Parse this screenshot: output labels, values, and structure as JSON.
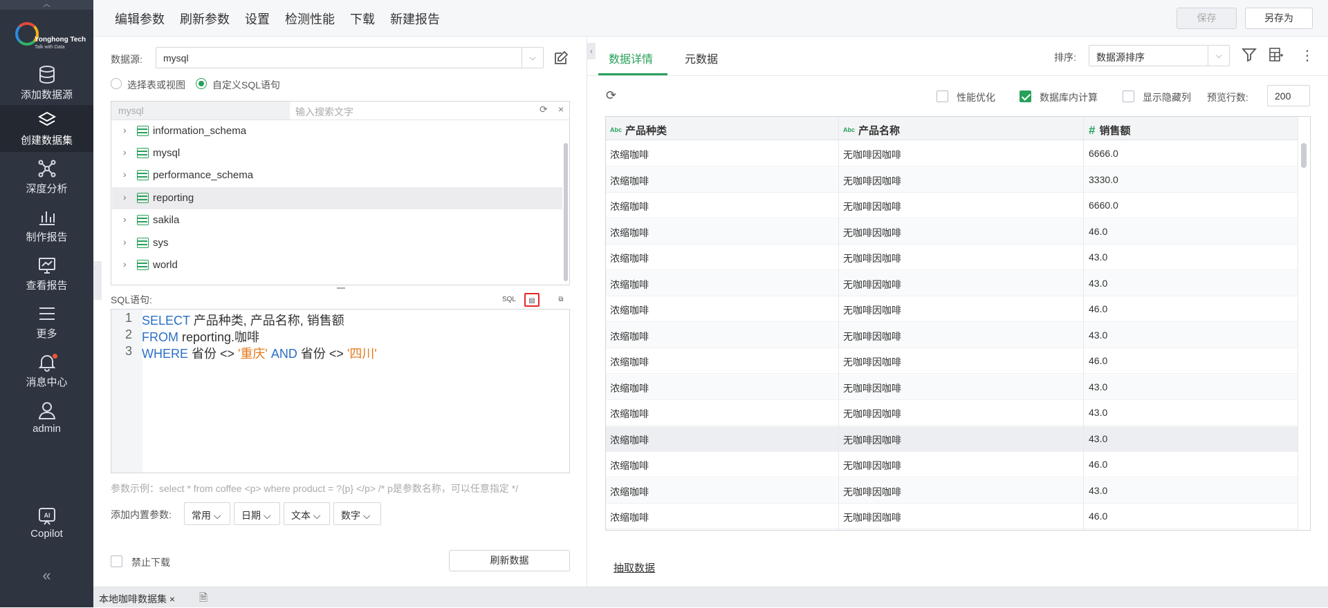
{
  "nav": {
    "logo_brand": "Yonghong Tech",
    "logo_slogan": "Talk with Data",
    "items": [
      {
        "label": "添加数据源",
        "icon": "database-icon"
      },
      {
        "label": "创建数据集",
        "icon": "layers-icon"
      },
      {
        "label": "深度分析",
        "icon": "network-icon"
      },
      {
        "label": "制作报告",
        "icon": "bar-chart-icon"
      },
      {
        "label": "查看报告",
        "icon": "monitor-chart-icon"
      },
      {
        "label": "更多",
        "icon": "menu-icon"
      },
      {
        "label": "消息中心",
        "icon": "bell-icon"
      },
      {
        "label": "admin",
        "icon": "user-icon"
      },
      {
        "label": "Copilot",
        "icon": "ai-icon"
      }
    ],
    "active_item": "创建数据集"
  },
  "topbar": {
    "menu": [
      "编辑参数",
      "刷新参数",
      "设置",
      "检测性能",
      "下载",
      "新建报告"
    ],
    "save_label": "保存",
    "save_as_label": "另存为"
  },
  "left": {
    "datasource_label": "数据源:",
    "datasource_value": "mysql",
    "radio_table": "选择表或视图",
    "radio_sql": "自定义SQL语句",
    "tree_db": "mysql",
    "tree_search_placeholder": "输入搜索文字",
    "schemas": [
      "information_schema",
      "mysql",
      "performance_schema",
      "reporting",
      "sakila",
      "sys",
      "world"
    ],
    "selected_schema": "reporting",
    "sql_label": "SQL语句:",
    "sql_lines": [
      {
        "no": "1",
        "kw1": "SELECT",
        "t1": " 产品种类, 产品名称, 销售额"
      },
      {
        "no": "2",
        "kw1": "FROM",
        "t1": " reporting.咖啡"
      },
      {
        "no": "3",
        "kw1": "WHERE",
        "t1": " 省份 <> ",
        "s1": "'重庆'",
        "kw2": " AND",
        "t2": " 省份 <> ",
        "s2": "'四川'"
      }
    ],
    "param_hint": "参数示例：select * from coffee <p> where product = ?{p} </p> /* p是参数名称，可以任意指定 */",
    "add_param_label": "添加内置参数:",
    "param_dropdowns": [
      "常用",
      "日期",
      "文本",
      "数字"
    ],
    "disable_download_label": "禁止下载",
    "refresh_data_label": "刷新数据",
    "sql_icon_text": "SQL"
  },
  "right": {
    "tab_detail": "数据详情",
    "tab_meta": "元数据",
    "sort_label": "排序:",
    "sort_value": "数据源排序",
    "perf_opt_label": "性能优化",
    "db_compute_label": "数据库内计算",
    "show_hidden_label": "显示隐藏列",
    "preview_rows_label": "预览行数:",
    "preview_rows_value": "200",
    "extract_label": "抽取数据",
    "columns": [
      {
        "type": "Abc",
        "name": "产品种类"
      },
      {
        "type": "Abc",
        "name": "产品名称"
      },
      {
        "type": "#",
        "name": "销售额"
      }
    ],
    "rows": [
      [
        "浓缩咖啡",
        "无咖啡因咖啡",
        "6666.0"
      ],
      [
        "浓缩咖啡",
        "无咖啡因咖啡",
        "3330.0"
      ],
      [
        "浓缩咖啡",
        "无咖啡因咖啡",
        "6660.0"
      ],
      [
        "浓缩咖啡",
        "无咖啡因咖啡",
        "46.0"
      ],
      [
        "浓缩咖啡",
        "无咖啡因咖啡",
        "43.0"
      ],
      [
        "浓缩咖啡",
        "无咖啡因咖啡",
        "43.0"
      ],
      [
        "浓缩咖啡",
        "无咖啡因咖啡",
        "46.0"
      ],
      [
        "浓缩咖啡",
        "无咖啡因咖啡",
        "43.0"
      ],
      [
        "浓缩咖啡",
        "无咖啡因咖啡",
        "46.0"
      ],
      [
        "浓缩咖啡",
        "无咖啡因咖啡",
        "43.0"
      ],
      [
        "浓缩咖啡",
        "无咖啡因咖啡",
        "43.0"
      ],
      [
        "浓缩咖啡",
        "无咖啡因咖啡",
        "43.0"
      ],
      [
        "浓缩咖啡",
        "无咖啡因咖啡",
        "46.0"
      ],
      [
        "浓缩咖啡",
        "无咖啡因咖啡",
        "43.0"
      ],
      [
        "浓缩咖啡",
        "无咖啡因咖啡",
        "46.0"
      ]
    ]
  },
  "status": {
    "tab_name": "本地咖啡数据集"
  },
  "colors": {
    "accent": "#27a05a",
    "nav_bg": "#2e3440",
    "highlight_border": "#e5252a",
    "sql_keyword": "#2a6fc4",
    "sql_string": "#e27a1b"
  }
}
